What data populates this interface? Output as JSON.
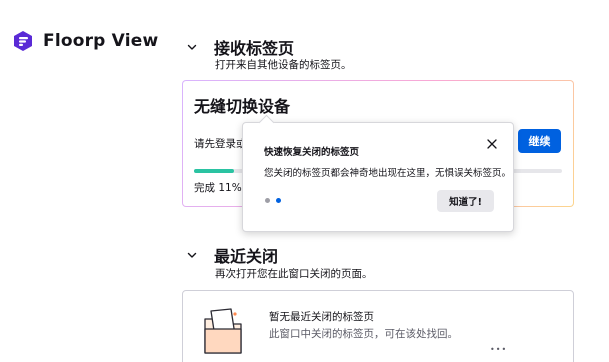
{
  "app": {
    "brand_name": "Floorp View"
  },
  "synced_tabs": {
    "header": "接收标签页",
    "description": "打开来自其他设备的标签页。",
    "card_title": "无缝切换设备",
    "prompt_text": "请先登录或",
    "continue_label": "继续",
    "progress_label": "完成 11%",
    "progress_fraction": 0.11
  },
  "recently_closed": {
    "header": "最近关闭",
    "description": "再次打开您在此窗口关闭的页面。",
    "empty_title": "暂无最近关闭的标签页",
    "empty_subtitle": "此窗口中关闭的标签页，可在该处找回。",
    "loading_indicator": "•••"
  },
  "callout": {
    "title": "快速恢复关闭的标签页",
    "body": "您关闭的标签页都会神奇地出现在这里，无惧误关标签页。",
    "got_it_label": "知道了!",
    "step_current": 2,
    "step_total": 2
  },
  "icons": {
    "brand": "floorp-logo-icon",
    "collapse": "chevron-down-icon",
    "close": "close-icon",
    "empty_state": "empty-folder-illustration-icon"
  },
  "colors": {
    "brand_purple": "#5a2ad6",
    "accent_blue": "#0061e0",
    "progress_green": "#2ac3a2"
  }
}
